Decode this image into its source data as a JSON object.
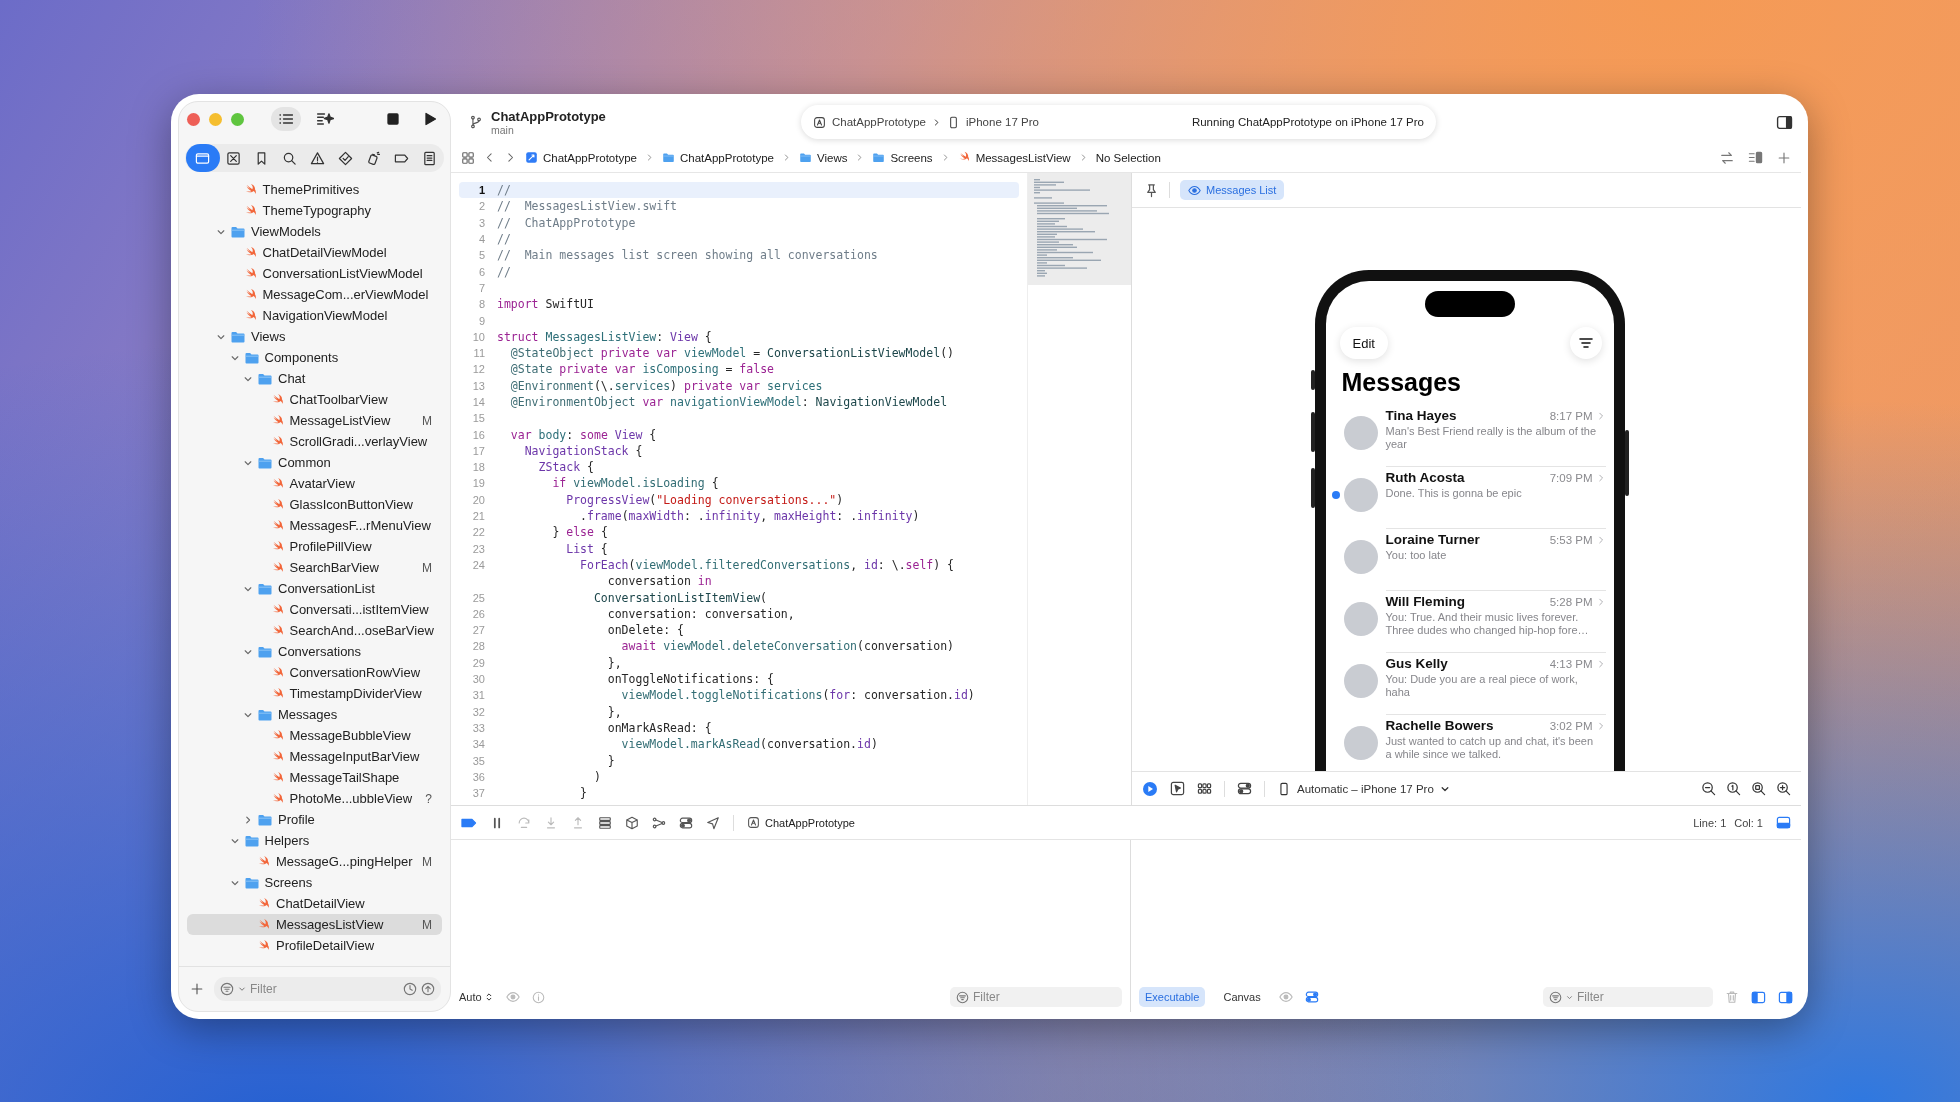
{
  "project": {
    "name": "ChatAppPrototype",
    "branch": "main"
  },
  "scheme": {
    "target": "ChatAppPrototype",
    "device": "iPhone 17 Pro",
    "status": "Running ChatAppPrototype on iPhone 17 Pro"
  },
  "navigator_tabs": [
    {
      "kind": "project",
      "selected": true
    },
    {
      "kind": "source-control",
      "selected": false
    },
    {
      "kind": "bookmarks",
      "selected": false
    },
    {
      "kind": "find",
      "selected": false
    },
    {
      "kind": "issues",
      "selected": false
    },
    {
      "kind": "tests",
      "selected": false
    },
    {
      "kind": "debug",
      "selected": false
    },
    {
      "kind": "breakpoints",
      "selected": false
    },
    {
      "kind": "reports",
      "selected": false
    }
  ],
  "sidebar": {
    "tree": [
      {
        "kind": "continued",
        "children": [
          {
            "kind": "swift",
            "label": "ThemePrimitives",
            "selected": false
          },
          {
            "kind": "swift",
            "label": "ThemeTypography",
            "selected": false
          }
        ]
      },
      {
        "kind": "folder",
        "label": "ViewModels",
        "expanded": true,
        "selected": false,
        "children": [
          {
            "kind": "swift",
            "label": "ChatDetailViewModel",
            "selected": false
          },
          {
            "kind": "swift",
            "label": "ConversationListViewModel",
            "selected": false
          },
          {
            "kind": "swift",
            "label": "MessageCom...erViewModel",
            "selected": false
          },
          {
            "kind": "swift",
            "label": "NavigationViewModel",
            "selected": false
          }
        ]
      },
      {
        "kind": "folder",
        "label": "Views",
        "expanded": true,
        "selected": false,
        "children": [
          {
            "kind": "folder",
            "label": "Components",
            "expanded": true,
            "selected": false,
            "children": [
              {
                "kind": "folder",
                "label": "Chat",
                "expanded": true,
                "selected": false,
                "children": [
                  {
                    "kind": "swift",
                    "label": "ChatToolbarView",
                    "selected": false
                  },
                  {
                    "kind": "swift",
                    "label": "MessageListView",
                    "badge": "M",
                    "selected": false
                  },
                  {
                    "kind": "swift",
                    "label": "ScrollGradi...verlayView",
                    "selected": false
                  }
                ]
              },
              {
                "kind": "folder",
                "label": "Common",
                "expanded": true,
                "selected": false,
                "children": [
                  {
                    "kind": "swift",
                    "label": "AvatarView",
                    "selected": false
                  },
                  {
                    "kind": "swift",
                    "label": "GlassIconButtonView",
                    "selected": false
                  },
                  {
                    "kind": "swift",
                    "label": "MessagesF...rMenuView",
                    "selected": false
                  },
                  {
                    "kind": "swift",
                    "label": "ProfilePillView",
                    "selected": false
                  },
                  {
                    "kind": "swift",
                    "label": "SearchBarView",
                    "badge": "M",
                    "selected": false
                  }
                ]
              },
              {
                "kind": "folder",
                "label": "ConversationList",
                "expanded": true,
                "selected": false,
                "children": [
                  {
                    "kind": "swift",
                    "label": "Conversati...istItemView",
                    "selected": false
                  },
                  {
                    "kind": "swift",
                    "label": "SearchAnd...oseBarView",
                    "selected": false
                  }
                ]
              },
              {
                "kind": "folder",
                "label": "Conversations",
                "expanded": true,
                "selected": false,
                "children": [
                  {
                    "kind": "swift",
                    "label": "ConversationRowView",
                    "selected": false
                  },
                  {
                    "kind": "swift",
                    "label": "TimestampDividerView",
                    "selected": false
                  }
                ]
              },
              {
                "kind": "folder",
                "label": "Messages",
                "expanded": true,
                "selected": false,
                "children": [
                  {
                    "kind": "swift",
                    "label": "MessageBubbleView",
                    "selected": false
                  },
                  {
                    "kind": "swift",
                    "label": "MessageInputBarView",
                    "selected": false
                  },
                  {
                    "kind": "swift",
                    "label": "MessageTailShape",
                    "selected": false
                  },
                  {
                    "kind": "swift",
                    "label": "PhotoMe...ubbleView",
                    "badge": "?",
                    "selected": false
                  }
                ]
              },
              {
                "kind": "folder",
                "label": "Profile",
                "expanded": false,
                "selected": false
              }
            ]
          },
          {
            "kind": "folder",
            "label": "Helpers",
            "expanded": true,
            "selected": false,
            "children": [
              {
                "kind": "swift",
                "label": "MessageG...pingHelper",
                "badge": "M",
                "selected": false
              }
            ]
          },
          {
            "kind": "folder",
            "label": "Screens",
            "expanded": true,
            "selected": false,
            "children": [
              {
                "kind": "swift",
                "label": "ChatDetailView",
                "selected": false
              },
              {
                "kind": "swift",
                "label": "MessagesListView",
                "badge": "M",
                "selected": true
              },
              {
                "kind": "swift",
                "label": "ProfileDetailView",
                "selected": false
              }
            ]
          }
        ]
      }
    ],
    "filter": {
      "placeholder": "Filter"
    }
  },
  "jump_bar": {
    "crumbs": [
      {
        "kind": "project",
        "label": "ChatAppPrototype"
      },
      {
        "kind": "folder",
        "label": "ChatAppPrototype"
      },
      {
        "kind": "folder",
        "label": "Views"
      },
      {
        "kind": "folder",
        "label": "Screens"
      },
      {
        "kind": "swift",
        "label": "MessagesListView"
      },
      {
        "kind": "none",
        "label": "No Selection"
      }
    ]
  },
  "editor": {
    "lines": [
      {
        "number": "1",
        "current": true,
        "tokens": [
          {
            "kind": "comment",
            "text": "//"
          }
        ]
      },
      {
        "number": "2",
        "current": false,
        "tokens": [
          {
            "kind": "comment",
            "text": "//  MessagesListView.swift"
          }
        ]
      },
      {
        "number": "3",
        "current": false,
        "tokens": [
          {
            "kind": "comment",
            "text": "//  ChatAppPrototype"
          }
        ]
      },
      {
        "number": "4",
        "current": false,
        "tokens": [
          {
            "kind": "comment",
            "text": "//"
          }
        ]
      },
      {
        "number": "5",
        "current": false,
        "tokens": [
          {
            "kind": "comment",
            "text": "//  Main messages list screen showing all conversations"
          }
        ]
      },
      {
        "number": "6",
        "current": false,
        "tokens": [
          {
            "kind": "comment",
            "text": "//"
          }
        ]
      },
      {
        "number": "7",
        "current": false
      },
      {
        "number": "8",
        "current": false,
        "tokens": [
          {
            "kind": "keyword",
            "text": "import"
          },
          {
            "kind": "plain",
            "text": " SwiftUI"
          }
        ]
      },
      {
        "number": "9",
        "current": false
      },
      {
        "number": "10",
        "current": false,
        "tokens": [
          {
            "kind": "keyword",
            "text": "struct "
          },
          {
            "kind": "decl",
            "text": "MessagesListView"
          },
          {
            "kind": "plain",
            "text": ": "
          },
          {
            "kind": "systype",
            "text": "View"
          },
          {
            "kind": "plain",
            "text": " {"
          }
        ]
      },
      {
        "number": "11",
        "current": false,
        "tokens": [
          {
            "kind": "attr",
            "text": "  @StateObject "
          },
          {
            "kind": "keyword",
            "text": "private var "
          },
          {
            "kind": "decl",
            "text": "viewModel"
          },
          {
            "kind": "plain",
            "text": " = "
          },
          {
            "kind": "ref",
            "text": "ConversationListViewModel"
          },
          {
            "kind": "plain",
            "text": "()"
          }
        ]
      },
      {
        "number": "12",
        "current": false,
        "tokens": [
          {
            "kind": "attr",
            "text": "  @State "
          },
          {
            "kind": "keyword",
            "text": "private var "
          },
          {
            "kind": "decl",
            "text": "isComposing"
          },
          {
            "kind": "plain",
            "text": " = "
          },
          {
            "kind": "keyword",
            "text": "false"
          }
        ]
      },
      {
        "number": "13",
        "current": false,
        "tokens": [
          {
            "kind": "attr",
            "text": "  @Environment"
          },
          {
            "kind": "plain",
            "text": "(\\."
          },
          {
            "kind": "prop",
            "text": "services"
          },
          {
            "kind": "plain",
            "text": ") "
          },
          {
            "kind": "keyword",
            "text": "private var "
          },
          {
            "kind": "decl",
            "text": "services"
          }
        ]
      },
      {
        "number": "14",
        "current": false,
        "tokens": [
          {
            "kind": "attr",
            "text": "  @EnvironmentObject "
          },
          {
            "kind": "keyword",
            "text": "var "
          },
          {
            "kind": "decl",
            "text": "navigationViewModel"
          },
          {
            "kind": "plain",
            "text": ": "
          },
          {
            "kind": "ref",
            "text": "NavigationViewModel"
          }
        ]
      },
      {
        "number": "15",
        "current": false
      },
      {
        "number": "16",
        "current": false,
        "tokens": [
          {
            "kind": "keyword",
            "text": "  var "
          },
          {
            "kind": "decl",
            "text": "body"
          },
          {
            "kind": "plain",
            "text": ": "
          },
          {
            "kind": "keyword",
            "text": "some "
          },
          {
            "kind": "systype",
            "text": "View"
          },
          {
            "kind": "plain",
            "text": " {"
          }
        ]
      },
      {
        "number": "17",
        "current": false,
        "tokens": [
          {
            "kind": "systype",
            "text": "    NavigationStack"
          },
          {
            "kind": "plain",
            "text": " {"
          }
        ]
      },
      {
        "number": "18",
        "current": false,
        "tokens": [
          {
            "kind": "systype",
            "text": "      ZStack"
          },
          {
            "kind": "plain",
            "text": " {"
          }
        ]
      },
      {
        "number": "19",
        "current": false,
        "tokens": [
          {
            "kind": "keyword",
            "text": "        if "
          },
          {
            "kind": "prop",
            "text": "viewModel.isLoading"
          },
          {
            "kind": "plain",
            "text": " {"
          }
        ]
      },
      {
        "number": "20",
        "current": false,
        "tokens": [
          {
            "kind": "systype",
            "text": "          ProgressView"
          },
          {
            "kind": "plain",
            "text": "("
          },
          {
            "kind": "string",
            "text": "\"Loading conversations...\""
          },
          {
            "kind": "plain",
            "text": ")"
          }
        ]
      },
      {
        "number": "21",
        "current": false,
        "tokens": [
          {
            "kind": "plain",
            "text": "            ."
          },
          {
            "kind": "sysfn",
            "text": "frame"
          },
          {
            "kind": "plain",
            "text": "("
          },
          {
            "kind": "sysfn",
            "text": "maxWidth"
          },
          {
            "kind": "plain",
            "text": ": ."
          },
          {
            "kind": "sysfn",
            "text": "infinity"
          },
          {
            "kind": "plain",
            "text": ", "
          },
          {
            "kind": "sysfn",
            "text": "maxHeight"
          },
          {
            "kind": "plain",
            "text": ": ."
          },
          {
            "kind": "sysfn",
            "text": "infinity"
          },
          {
            "kind": "plain",
            "text": ")"
          }
        ]
      },
      {
        "number": "22",
        "current": false,
        "tokens": [
          {
            "kind": "plain",
            "text": "        } "
          },
          {
            "kind": "keyword",
            "text": "else"
          },
          {
            "kind": "plain",
            "text": " {"
          }
        ]
      },
      {
        "number": "23",
        "current": false,
        "tokens": [
          {
            "kind": "systype",
            "text": "          List"
          },
          {
            "kind": "plain",
            "text": " {"
          }
        ]
      },
      {
        "number": "24",
        "current": false,
        "tokens": [
          {
            "kind": "systype",
            "text": "            ForEach"
          },
          {
            "kind": "plain",
            "text": "("
          },
          {
            "kind": "prop",
            "text": "viewModel.filteredConversations"
          },
          {
            "kind": "plain",
            "text": ", "
          },
          {
            "kind": "sysfn",
            "text": "id"
          },
          {
            "kind": "plain",
            "text": ": \\."
          },
          {
            "kind": "keyword",
            "text": "self"
          },
          {
            "kind": "plain",
            "text": ") {"
          }
        ]
      },
      {
        "current": false,
        "tokens": [
          {
            "kind": "plain",
            "text": "                conversation "
          },
          {
            "kind": "keyword",
            "text": "in"
          }
        ]
      },
      {
        "number": "25",
        "current": false,
        "tokens": [
          {
            "kind": "ref",
            "text": "              ConversationListItemView"
          },
          {
            "kind": "plain",
            "text": "("
          }
        ]
      },
      {
        "number": "26",
        "current": false,
        "tokens": [
          {
            "kind": "plain",
            "text": "                conversation: conversation,"
          }
        ]
      },
      {
        "number": "27",
        "current": false,
        "tokens": [
          {
            "kind": "plain",
            "text": "                onDelete: {"
          }
        ]
      },
      {
        "number": "28",
        "current": false,
        "tokens": [
          {
            "kind": "keyword",
            "text": "                  await "
          },
          {
            "kind": "prop",
            "text": "viewModel.deleteConversation"
          },
          {
            "kind": "plain",
            "text": "(conversation)"
          }
        ]
      },
      {
        "number": "29",
        "current": false,
        "tokens": [
          {
            "kind": "plain",
            "text": "                },"
          }
        ]
      },
      {
        "number": "30",
        "current": false,
        "tokens": [
          {
            "kind": "plain",
            "text": "                onToggleNotifications: {"
          }
        ]
      },
      {
        "number": "31",
        "current": false,
        "tokens": [
          {
            "kind": "prop",
            "text": "                  viewModel.toggleNotifications"
          },
          {
            "kind": "plain",
            "text": "("
          },
          {
            "kind": "sysfn",
            "text": "for"
          },
          {
            "kind": "plain",
            "text": ": conversation."
          },
          {
            "kind": "sysfn",
            "text": "id"
          },
          {
            "kind": "plain",
            "text": ")"
          }
        ]
      },
      {
        "number": "32",
        "current": false,
        "tokens": [
          {
            "kind": "plain",
            "text": "                },"
          }
        ]
      },
      {
        "number": "33",
        "current": false,
        "tokens": [
          {
            "kind": "plain",
            "text": "                onMarkAsRead: {"
          }
        ]
      },
      {
        "number": "34",
        "current": false,
        "tokens": [
          {
            "kind": "prop",
            "text": "                  viewModel.markAsRead"
          },
          {
            "kind": "plain",
            "text": "(conversation."
          },
          {
            "kind": "sysfn",
            "text": "id"
          },
          {
            "kind": "plain",
            "text": ")"
          }
        ]
      },
      {
        "number": "35",
        "current": false,
        "tokens": [
          {
            "kind": "plain",
            "text": "                }"
          }
        ]
      },
      {
        "number": "36",
        "current": false,
        "tokens": [
          {
            "kind": "plain",
            "text": "              )"
          }
        ]
      },
      {
        "number": "37",
        "current": false,
        "tokens": [
          {
            "kind": "plain",
            "text": "            }"
          }
        ]
      }
    ]
  },
  "preview": {
    "tabs": [
      {
        "label": "Messages List",
        "selected": true
      }
    ],
    "screen": {
      "edit": "Edit",
      "title": "Messages",
      "conversations": [
        {
          "name": "Tina Hayes",
          "time": "8:17 PM",
          "preview": "Man's Best Friend really is the album of the year",
          "unread": false
        },
        {
          "name": "Ruth Acosta",
          "time": "7:09 PM",
          "preview": "Done. This is gonna be epic",
          "unread": true
        },
        {
          "name": "Loraine Turner",
          "time": "5:53 PM",
          "preview": "You: too late",
          "unread": false
        },
        {
          "name": "Will Fleming",
          "time": "5:28 PM",
          "preview": "You: True. And their music lives forever. Three dudes who changed hip-hop fore…",
          "unread": false
        },
        {
          "name": "Gus Kelly",
          "time": "4:13 PM",
          "preview": "You: Dude you are a real piece of work, haha",
          "unread": false
        },
        {
          "name": "Rachelle Bowers",
          "time": "3:02 PM",
          "preview": "Just wanted to catch up and chat, it's been a while since we talked.",
          "unread": false
        }
      ]
    },
    "device_menu": "Automatic – iPhone 17 Pro"
  },
  "debug_bar": {
    "target": "ChatAppPrototype",
    "line": "Line: 1",
    "column": "Col: 1"
  },
  "console": {
    "mode": "Auto",
    "filter": {
      "placeholder": "Filter"
    }
  },
  "variables": {
    "scopes": [
      {
        "label": "Executable",
        "selected": true
      },
      {
        "label": "Canvas",
        "selected": false
      }
    ],
    "filter": {
      "placeholder": "Filter"
    }
  }
}
